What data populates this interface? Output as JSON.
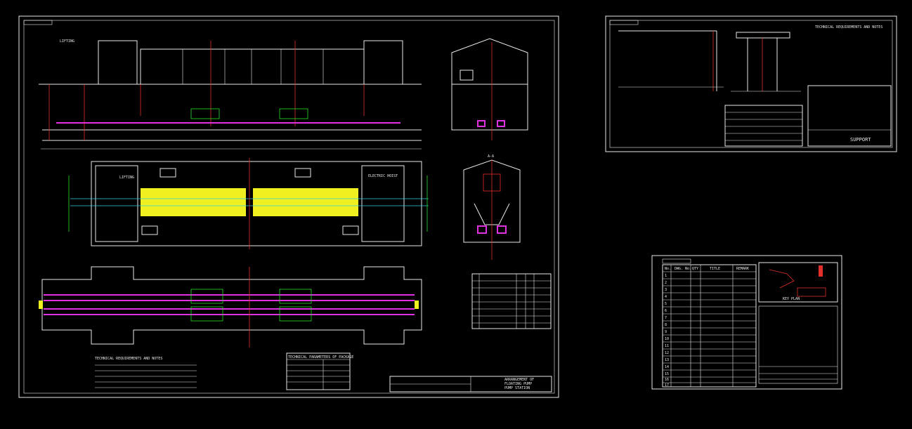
{
  "sheet_main": {
    "plan_label_top": "LIFTING",
    "plan_label_right": "ELECTRIC HOIST",
    "key_section_label": "A-A",
    "technical_params_title": "TECHNICAL PARAMETERS OF PACKAGE",
    "technical_notes_title": "TECHNICAL REQUIREMENTS AND NOTES",
    "title_block": [
      "ARRANGEMENT OF",
      "FLOATING PUMP",
      "PUMP STATION"
    ]
  },
  "sheet_support": {
    "title": "SUPPORT",
    "notes_title": "TECHNICAL REQUIREMENTS AND NOTES"
  },
  "sheet_index": {
    "headers": [
      "No.",
      "DWG. No.",
      "QTY",
      "TITLE",
      "REMARK"
    ],
    "rows": [
      "1",
      "2",
      "3",
      "4",
      "5",
      "6",
      "7",
      "8",
      "9",
      "10",
      "11",
      "12",
      "13",
      "14",
      "15",
      "16",
      "17"
    ],
    "key_plan_label": "KEY PLAN"
  },
  "colors": {
    "background": "#000000",
    "line": "#e8e8e8",
    "red": "#e0302a",
    "green": "#28e028",
    "magenta": "#e030e0",
    "yellow": "#f0f020",
    "cyan": "#30d0e0"
  }
}
